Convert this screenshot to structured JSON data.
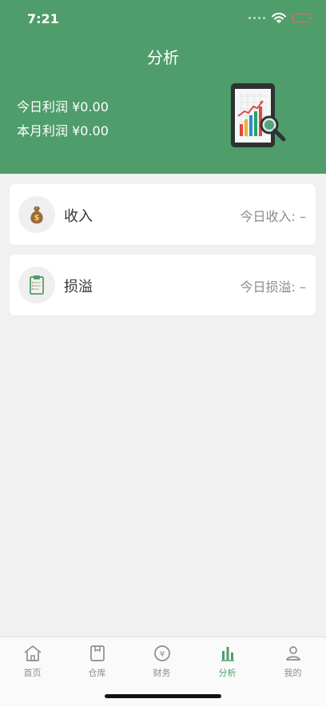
{
  "status": {
    "time": "7:21"
  },
  "header": {
    "title": "分析",
    "today_profit": "今日利润 ¥0.00",
    "month_profit": "本月利润 ¥0.00"
  },
  "cards": [
    {
      "title": "收入",
      "value": "今日收入: –",
      "icon": "money-bag-icon"
    },
    {
      "title": "损溢",
      "value": "今日损溢: –",
      "icon": "clipboard-icon"
    }
  ],
  "tabbar": [
    {
      "label": "首页",
      "icon": "home-icon",
      "active": false
    },
    {
      "label": "仓库",
      "icon": "warehouse-icon",
      "active": false
    },
    {
      "label": "财务",
      "icon": "finance-icon",
      "active": false
    },
    {
      "label": "分析",
      "icon": "analysis-icon",
      "active": true
    },
    {
      "label": "我的",
      "icon": "profile-icon",
      "active": false
    }
  ],
  "colors": {
    "header_green": "#4f9d6b",
    "active_tab_green": "#4f9d6b"
  }
}
